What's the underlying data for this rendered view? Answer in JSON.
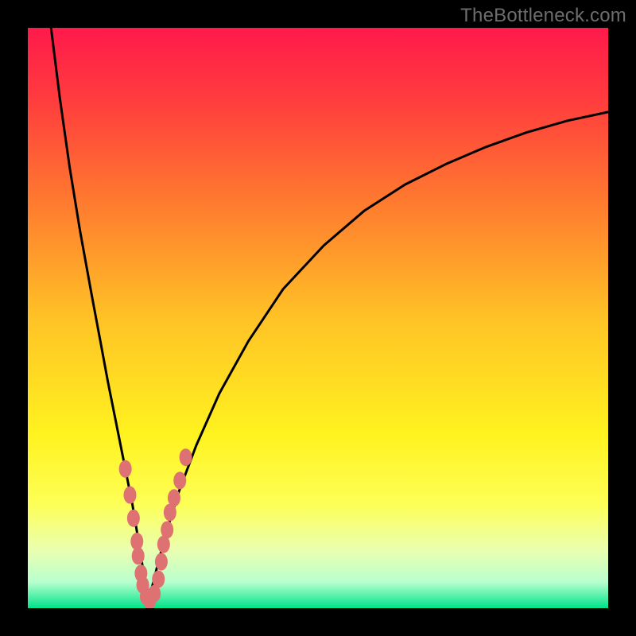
{
  "watermark": "TheBottleneck.com",
  "chart_data": {
    "type": "line",
    "title": "",
    "xlabel": "",
    "ylabel": "",
    "xlim": [
      0,
      100
    ],
    "ylim": [
      0,
      100
    ],
    "grid": false,
    "legend": false,
    "background_gradient": {
      "stops": [
        {
          "pos": 0.0,
          "color": "#ff1a4b"
        },
        {
          "pos": 0.12,
          "color": "#ff3b3e"
        },
        {
          "pos": 0.3,
          "color": "#ff7a2f"
        },
        {
          "pos": 0.5,
          "color": "#ffc226"
        },
        {
          "pos": 0.7,
          "color": "#fff21f"
        },
        {
          "pos": 0.82,
          "color": "#fdff56"
        },
        {
          "pos": 0.9,
          "color": "#eaffb0"
        },
        {
          "pos": 0.955,
          "color": "#b8ffce"
        },
        {
          "pos": 1.0,
          "color": "#00e48a"
        }
      ]
    },
    "series": [
      {
        "name": "left-branch",
        "stroke": "#000000",
        "x": [
          4.0,
          5.5,
          7.2,
          9.0,
          11.0,
          12.5,
          13.8,
          15.0,
          16.2,
          17.2,
          18.0,
          18.5,
          19.0,
          19.4,
          19.8,
          20.0,
          20.4,
          20.8
        ],
        "y": [
          100.0,
          88.0,
          76.0,
          65.0,
          54.0,
          46.0,
          39.0,
          33.0,
          27.0,
          22.0,
          18.0,
          15.0,
          12.0,
          9.5,
          7.0,
          5.0,
          3.0,
          1.0
        ]
      },
      {
        "name": "right-branch",
        "stroke": "#000000",
        "x": [
          20.8,
          21.5,
          22.5,
          24.0,
          26.0,
          29.0,
          33.0,
          38.0,
          44.0,
          51.0,
          58.0,
          65.0,
          72.0,
          79.0,
          86.0,
          93.0,
          100.0
        ],
        "y": [
          1.0,
          4.0,
          8.0,
          13.5,
          20.0,
          28.0,
          37.0,
          46.0,
          55.0,
          62.5,
          68.5,
          73.0,
          76.5,
          79.5,
          82.0,
          84.0,
          85.5
        ]
      }
    ],
    "markers": [
      {
        "name": "left-cluster",
        "color": "#de7272",
        "points": [
          {
            "x": 16.8,
            "y": 24.0
          },
          {
            "x": 17.6,
            "y": 19.5
          },
          {
            "x": 18.2,
            "y": 15.5
          },
          {
            "x": 18.8,
            "y": 11.5
          },
          {
            "x": 19.0,
            "y": 9.0
          },
          {
            "x": 19.5,
            "y": 6.0
          },
          {
            "x": 19.8,
            "y": 4.0
          },
          {
            "x": 20.4,
            "y": 2.0
          },
          {
            "x": 21.0,
            "y": 1.3
          }
        ]
      },
      {
        "name": "right-cluster",
        "color": "#de7272",
        "points": [
          {
            "x": 21.8,
            "y": 2.5
          },
          {
            "x": 22.5,
            "y": 5.0
          },
          {
            "x": 23.0,
            "y": 8.0
          },
          {
            "x": 23.4,
            "y": 11.0
          },
          {
            "x": 24.0,
            "y": 13.5
          },
          {
            "x": 24.5,
            "y": 16.5
          },
          {
            "x": 25.2,
            "y": 19.0
          },
          {
            "x": 26.2,
            "y": 22.0
          },
          {
            "x": 27.2,
            "y": 26.0
          }
        ]
      }
    ]
  }
}
